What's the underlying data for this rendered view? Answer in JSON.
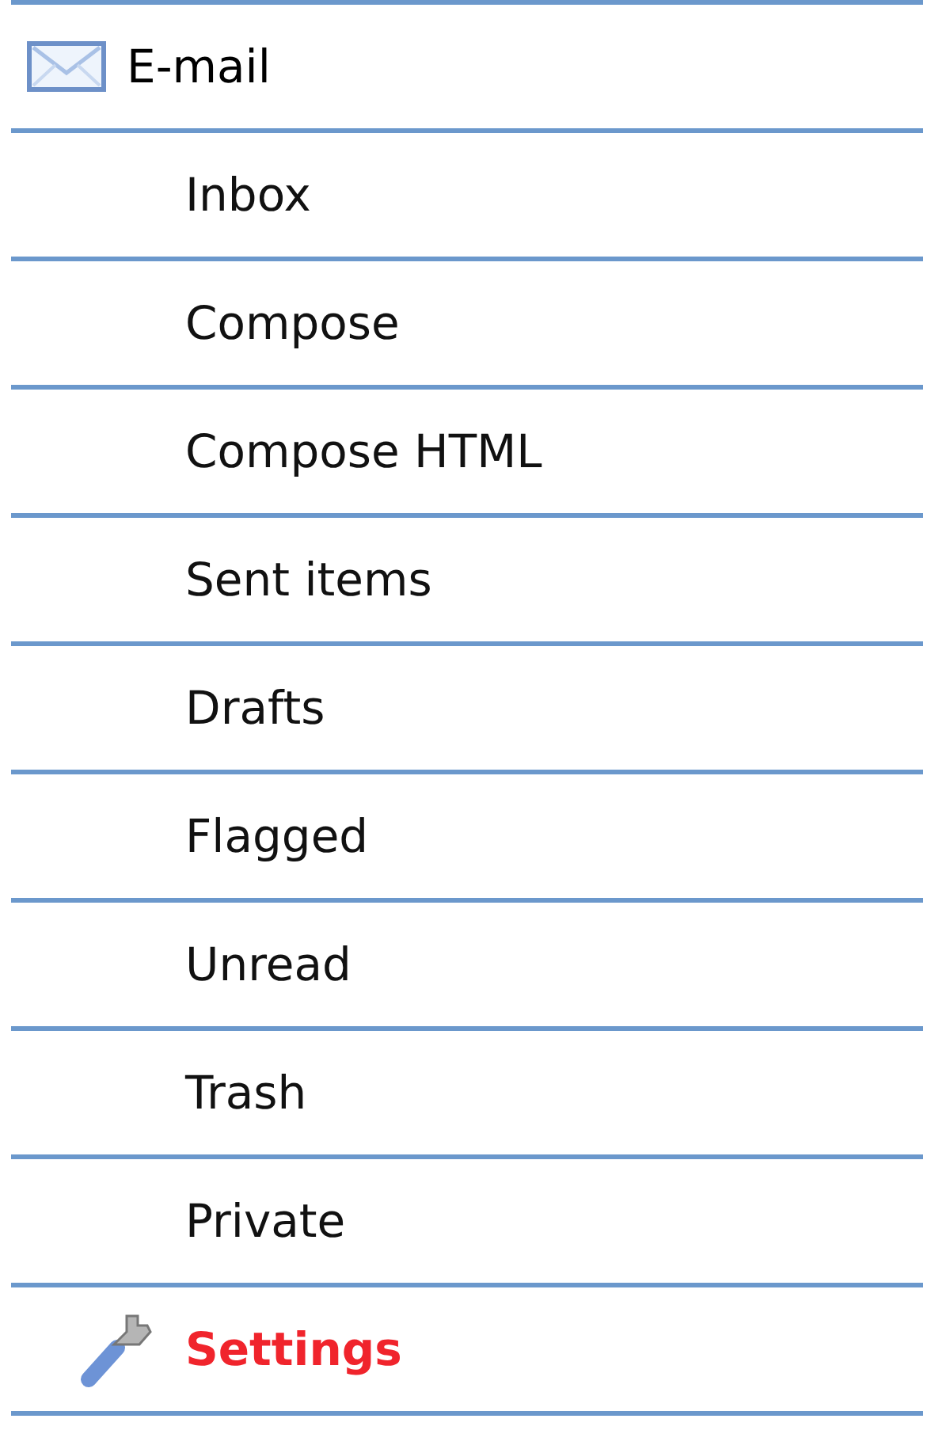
{
  "menu": {
    "header": {
      "label": "E-mail"
    },
    "items": [
      {
        "label": "Inbox",
        "selected": false,
        "kind": "plain"
      },
      {
        "label": "Compose",
        "selected": false,
        "kind": "plain"
      },
      {
        "label": "Compose HTML",
        "selected": false,
        "kind": "plain"
      },
      {
        "label": "Sent items",
        "selected": false,
        "kind": "plain"
      },
      {
        "label": "Drafts",
        "selected": false,
        "kind": "plain"
      },
      {
        "label": "Flagged",
        "selected": false,
        "kind": "plain"
      },
      {
        "label": "Unread",
        "selected": false,
        "kind": "plain"
      },
      {
        "label": "Trash",
        "selected": false,
        "kind": "plain"
      },
      {
        "label": "Private",
        "selected": false,
        "kind": "plain"
      },
      {
        "label": "Settings",
        "selected": true,
        "kind": "tool"
      }
    ]
  }
}
